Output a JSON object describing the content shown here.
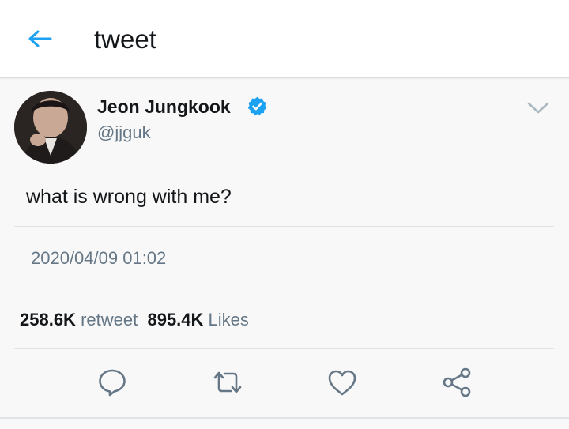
{
  "header": {
    "title": "tweet",
    "back_icon": "arrow-left-icon",
    "accent_color": "#1da1f2"
  },
  "tweet": {
    "display_name": "Jeon Jungkook",
    "verified_icon": "verified-badge-icon",
    "handle": "@jjguk",
    "text": "what is wrong with me?",
    "timestamp": "2020/04/09 01:02"
  },
  "stats": {
    "retweets_count": "258.6K",
    "retweets_label": "retweet",
    "likes_count": "895.4K",
    "likes_label": "Likes"
  },
  "actions": [
    {
      "name": "reply",
      "icon": "speech-bubble-icon"
    },
    {
      "name": "retweet",
      "icon": "retweet-arrows-icon"
    },
    {
      "name": "like",
      "icon": "heart-icon"
    },
    {
      "name": "share",
      "icon": "share-nodes-icon"
    }
  ],
  "colors": {
    "text_primary": "#14171a",
    "text_secondary": "#657786",
    "verified": "#1da1f2",
    "icon_gray": "#657786",
    "background": "#f8f8f8"
  }
}
